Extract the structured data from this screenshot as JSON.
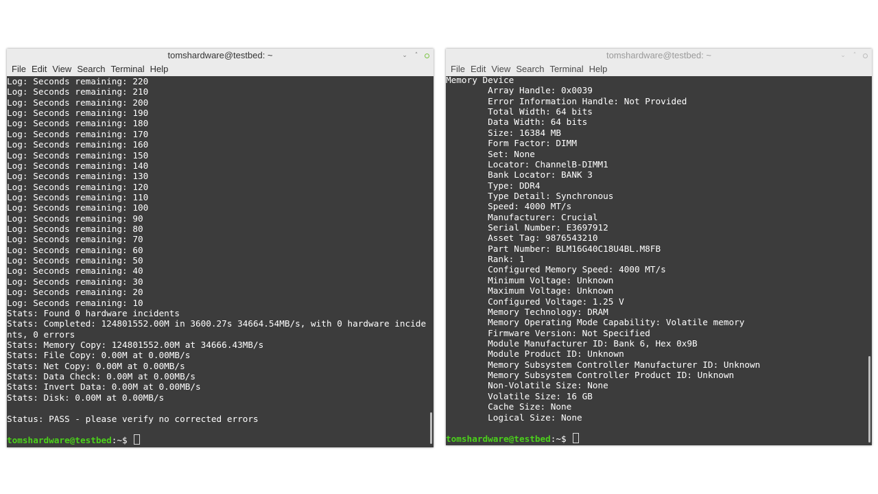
{
  "left_window": {
    "title": "tomshardware@testbed: ~",
    "menu": [
      "File",
      "Edit",
      "View",
      "Search",
      "Terminal",
      "Help"
    ],
    "lines": [
      "Log: Seconds remaining: 220",
      "Log: Seconds remaining: 210",
      "Log: Seconds remaining: 200",
      "Log: Seconds remaining: 190",
      "Log: Seconds remaining: 180",
      "Log: Seconds remaining: 170",
      "Log: Seconds remaining: 160",
      "Log: Seconds remaining: 150",
      "Log: Seconds remaining: 140",
      "Log: Seconds remaining: 130",
      "Log: Seconds remaining: 120",
      "Log: Seconds remaining: 110",
      "Log: Seconds remaining: 100",
      "Log: Seconds remaining: 90",
      "Log: Seconds remaining: 80",
      "Log: Seconds remaining: 70",
      "Log: Seconds remaining: 60",
      "Log: Seconds remaining: 50",
      "Log: Seconds remaining: 40",
      "Log: Seconds remaining: 30",
      "Log: Seconds remaining: 20",
      "Log: Seconds remaining: 10",
      "Stats: Found 0 hardware incidents",
      "Stats: Completed: 124801552.00M in 3600.27s 34664.54MB/s, with 0 hardware incide",
      "nts, 0 errors",
      "Stats: Memory Copy: 124801552.00M at 34666.43MB/s",
      "Stats: File Copy: 0.00M at 0.00MB/s",
      "Stats: Net Copy: 0.00M at 0.00MB/s",
      "Stats: Data Check: 0.00M at 0.00MB/s",
      "Stats: Invert Data: 0.00M at 0.00MB/s",
      "Stats: Disk: 0.00M at 0.00MB/s",
      "",
      "Status: PASS - please verify no corrected errors",
      ""
    ],
    "prompt": {
      "user": "tomshardware@testbed",
      "path": ":~$ "
    }
  },
  "right_window": {
    "title": "tomshardware@testbed: ~",
    "menu": [
      "File",
      "Edit",
      "View",
      "Search",
      "Terminal",
      "Help"
    ],
    "lines": [
      "Memory Device",
      "        Array Handle: 0x0039",
      "        Error Information Handle: Not Provided",
      "        Total Width: 64 bits",
      "        Data Width: 64 bits",
      "        Size: 16384 MB",
      "        Form Factor: DIMM",
      "        Set: None",
      "        Locator: ChannelB-DIMM1",
      "        Bank Locator: BANK 3",
      "        Type: DDR4",
      "        Type Detail: Synchronous",
      "        Speed: 4000 MT/s",
      "        Manufacturer: Crucial",
      "        Serial Number: E3697912",
      "        Asset Tag: 9876543210",
      "        Part Number: BLM16G40C18U4BL.M8FB",
      "        Rank: 1",
      "        Configured Memory Speed: 4000 MT/s",
      "        Minimum Voltage: Unknown",
      "        Maximum Voltage: Unknown",
      "        Configured Voltage: 1.25 V",
      "        Memory Technology: DRAM",
      "        Memory Operating Mode Capability: Volatile memory",
      "        Firmware Version: Not Specified",
      "        Module Manufacturer ID: Bank 6, Hex 0x9B",
      "        Module Product ID: Unknown",
      "        Memory Subsystem Controller Manufacturer ID: Unknown",
      "        Memory Subsystem Controller Product ID: Unknown",
      "        Non-Volatile Size: None",
      "        Volatile Size: 16 GB",
      "        Cache Size: None",
      "        Logical Size: None",
      ""
    ],
    "prompt": {
      "user": "tomshardware@testbed",
      "path": ":~$ "
    }
  }
}
